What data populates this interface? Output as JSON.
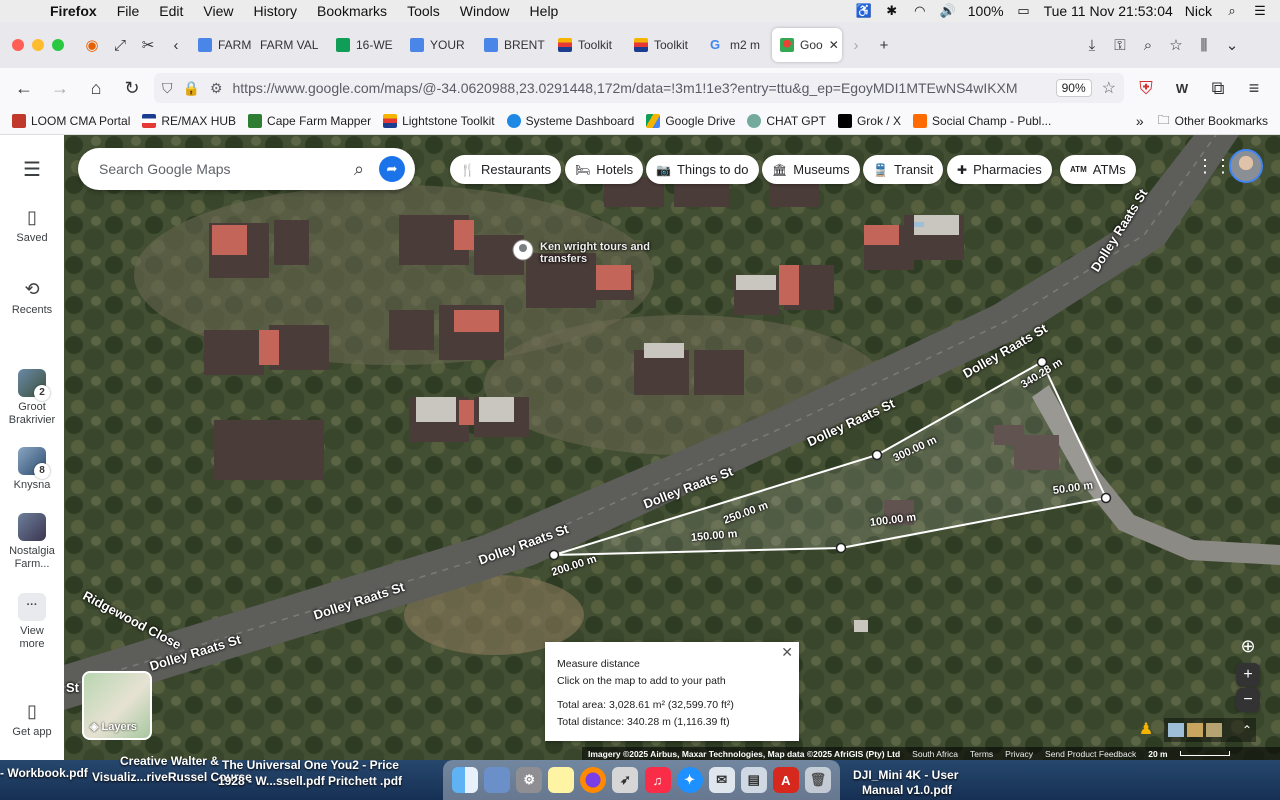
{
  "menubar": {
    "app": "Firefox",
    "items": [
      "File",
      "Edit",
      "View",
      "History",
      "Bookmarks",
      "Tools",
      "Window",
      "Help"
    ],
    "battery": "100%",
    "datetime": "Tue 11 Nov  21:53:04",
    "user": "Nick"
  },
  "tabs": [
    {
      "label": "FARM",
      "color": "#4a86e8"
    },
    {
      "label": "FARM VAL",
      "color": "#ffffff"
    },
    {
      "label": "16-WE",
      "color": "#0f9d58"
    },
    {
      "label": "YOUR",
      "color": "#4a86e8"
    },
    {
      "label": "BRENT",
      "color": "#4a86e8"
    },
    {
      "label": "Toolkit",
      "color": "#e53935"
    },
    {
      "label": "Toolkit",
      "color": "#e53935"
    },
    {
      "label": "m2 m",
      "color": "#ffffff"
    },
    {
      "label": "Goo",
      "color": "#34a853"
    }
  ],
  "urlbar": {
    "url": "https://www.google.com/maps/@-34.0620988,23.0291448,172m/data=!3m1!1e3?entry=ttu&g_ep=EgoyMDI1MTEwNS4wIKXM",
    "zoom": "90%"
  },
  "bookmarks": [
    {
      "label": "LOOM CMA Portal",
      "color": "#c0392b"
    },
    {
      "label": "RE/MAX HUB",
      "color": "#1a3d8f"
    },
    {
      "label": "Cape Farm Mapper",
      "color": "#2e7d32"
    },
    {
      "label": "Lightstone Toolkit",
      "color": "#f4b400"
    },
    {
      "label": "Systeme Dashboard",
      "color": "#1e88e5"
    },
    {
      "label": "Google Drive",
      "color": "#0f9d58"
    },
    {
      "label": "CHAT GPT",
      "color": "#74aa9c"
    },
    {
      "label": "Grok / X",
      "color": "#000000"
    },
    {
      "label": "Social Champ - Publ...",
      "color": "#ff6b00"
    }
  ],
  "other_bookmarks": "Other Bookmarks",
  "rail": {
    "saved": "Saved",
    "recents": "Recents",
    "places": [
      {
        "label": "Groot Brakrivier",
        "badge": "2"
      },
      {
        "label": "Knysna",
        "badge": "8"
      },
      {
        "label": "Nostalgia Farm...",
        "badge": ""
      }
    ],
    "view_more": "View more",
    "get_app": "Get app"
  },
  "search": {
    "placeholder": "Search Google Maps"
  },
  "chips": [
    "Restaurants",
    "Hotels",
    "Things to do",
    "Museums",
    "Transit",
    "Pharmacies",
    "ATMs"
  ],
  "map_labels": {
    "road": "Dolley Raats St",
    "close": "Ridgewood Close",
    "road_short": "St",
    "poi": "Ken wright tours and transfers"
  },
  "measure_labels": [
    "340.28 m",
    "300.00 m",
    "50.00 m",
    "250.00 m",
    "100.00 m",
    "150.00 m",
    "200.00 m"
  ],
  "measure_box": {
    "title": "Measure distance",
    "hint": "Click on the map to add to your path",
    "area": "Total area: 3,028.61 m² (32,599.70 ft²)",
    "distance": "Total distance: 340.28 m (1,116.39 ft)"
  },
  "layers": "Layers",
  "attribution": {
    "imagery": "Imagery ©2025 Airbus, Maxar Technologies, Map data ©2025 AfriGIS (Pty) Ltd",
    "country": "South Africa",
    "terms": "Terms",
    "privacy": "Privacy",
    "feedback": "Send Product Feedback",
    "scale": "20 m"
  },
  "desktop_files": [
    "Creative Walter &",
    "- Workbook.pdf",
    "Visualiz...riveRussel Course",
    "The Universal One You2 - Price",
    "1928 - W...ssell.pdf Pritchett .pdf",
    "DJI_Mini 4K - User",
    "Manual v1.0.pdf"
  ]
}
